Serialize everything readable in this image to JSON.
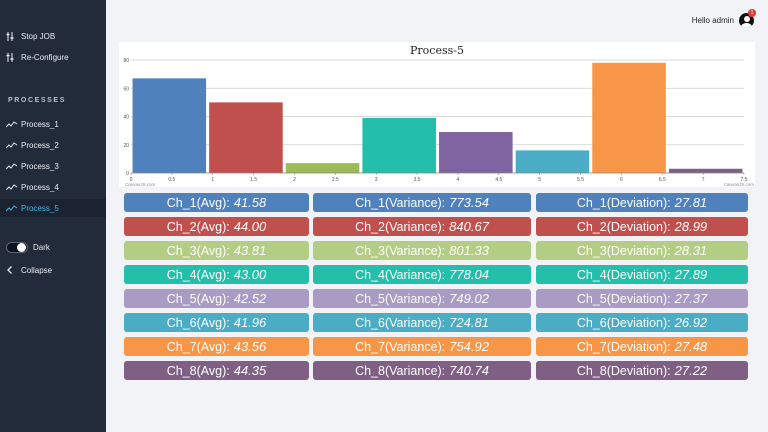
{
  "sidebar": {
    "top_items": [
      {
        "label": "Stop JOB",
        "icon": "sliders-icon"
      },
      {
        "label": "Re-Configure",
        "icon": "sliders-icon"
      }
    ],
    "section_header": "PROCESSES",
    "processes": [
      {
        "label": "Process_1",
        "icon": "chart-line-icon"
      },
      {
        "label": "Process_2",
        "icon": "chart-line-icon"
      },
      {
        "label": "Process_3",
        "icon": "chart-line-icon"
      },
      {
        "label": "Process_4",
        "icon": "chart-line-icon"
      },
      {
        "label": "Process_5",
        "icon": "chart-line-icon",
        "active": true
      }
    ],
    "dark_label": "Dark",
    "dark_enabled": true,
    "collapse_label": "Collapse"
  },
  "header": {
    "greeting": "Hello admin",
    "notification_count": "1"
  },
  "chart_data": {
    "type": "bar",
    "title": "Process-5",
    "xlabel": "",
    "ylabel": "",
    "x": [
      0.5,
      1.5,
      2.5,
      3.5,
      4.5,
      5.5,
      6.5,
      7.5
    ],
    "values": [
      67,
      50,
      7,
      39,
      29,
      16,
      78,
      3
    ],
    "colors": [
      "#4f81bd",
      "#c0504d",
      "#9bbb59",
      "#23bfaa",
      "#8064a2",
      "#4aacc5",
      "#f79646",
      "#7f6084"
    ],
    "xlim": [
      0,
      7.5
    ],
    "ylim": [
      0,
      80
    ],
    "x_ticks": [
      "0",
      "0.5",
      "1",
      "1.5",
      "2",
      "2.5",
      "3",
      "3.5",
      "4",
      "4.5",
      "5",
      "5.5",
      "6",
      "6.5",
      "7",
      "7.5"
    ],
    "y_ticks": [
      "0",
      "20",
      "40",
      "60",
      "80"
    ],
    "grid": true,
    "credits": "CanvasJS.com"
  },
  "stats": {
    "rows": [
      {
        "avg_label": "Ch_1(Avg):",
        "avg": "41.58",
        "var_label": "Ch_1(Variance):",
        "var": "773.54",
        "dev_label": "Ch_1(Deviation):",
        "dev": "27.81",
        "color": "#4f81bd"
      },
      {
        "avg_label": "Ch_2(Avg):",
        "avg": "44.00",
        "var_label": "Ch_2(Variance):",
        "var": "840.67",
        "dev_label": "Ch_2(Deviation):",
        "dev": "28.99",
        "color": "#c0504d"
      },
      {
        "avg_label": "Ch_3(Avg):",
        "avg": "43.81",
        "var_label": "Ch_3(Variance):",
        "var": "801.33",
        "dev_label": "Ch_3(Deviation):",
        "dev": "28.31",
        "color": "#b4cd85"
      },
      {
        "avg_label": "Ch_4(Avg):",
        "avg": "43.00",
        "var_label": "Ch_4(Variance):",
        "var": "778.04",
        "dev_label": "Ch_4(Deviation):",
        "dev": "27.89",
        "color": "#23bfaa"
      },
      {
        "avg_label": "Ch_5(Avg):",
        "avg": "42.52",
        "var_label": "Ch_5(Variance):",
        "var": "749.02",
        "dev_label": "Ch_5(Deviation):",
        "dev": "27.37",
        "color": "#a99bc4"
      },
      {
        "avg_label": "Ch_6(Avg):",
        "avg": "41.96",
        "var_label": "Ch_6(Variance):",
        "var": "724.81",
        "dev_label": "Ch_6(Deviation):",
        "dev": "26.92",
        "color": "#4aacc5"
      },
      {
        "avg_label": "Ch_7(Avg):",
        "avg": "43.56",
        "var_label": "Ch_7(Variance):",
        "var": "754.92",
        "dev_label": "Ch_7(Deviation):",
        "dev": "27.48",
        "color": "#f79646"
      },
      {
        "avg_label": "Ch_8(Avg):",
        "avg": "44.35",
        "var_label": "Ch_8(Variance):",
        "var": "740.74",
        "dev_label": "Ch_8(Deviation):",
        "dev": "27.22",
        "color": "#7f6084"
      }
    ]
  }
}
